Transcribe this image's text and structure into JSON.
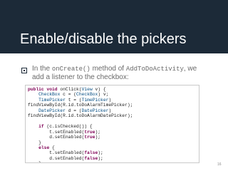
{
  "slide": {
    "title": "Enable/disable the pickers",
    "bullet": {
      "prefix": "In the ",
      "method": "onCreate()",
      "middle": " method of ",
      "class_name": "AddToDoActivity",
      "suffix": ", we add a listener to the checkbox:"
    },
    "code_lines": [
      "public void onClick(View v) {",
      "    CheckBox c = (CheckBox) v;",
      "    TimePicker t = (TimePicker)",
      "findViewById(R.id.toDoAlarmTimePicker);",
      "    DatePicker d = (DatePicker)",
      "findViewById(R.id.toDoAlarmDatePicker);",
      "",
      "    if (c.isChecked()) {",
      "        t.setEnabled(true);",
      "        d.setEnabled(true);",
      "    }",
      "    else {",
      "        t.setEnabled(false);",
      "        d.setEnabled(false);",
      "    }",
      "}"
    ],
    "page_number": "16",
    "colors": {
      "title_bar": "#1c2a38",
      "body_text": "#6a6a6a",
      "keyword": "#7f0055"
    }
  }
}
